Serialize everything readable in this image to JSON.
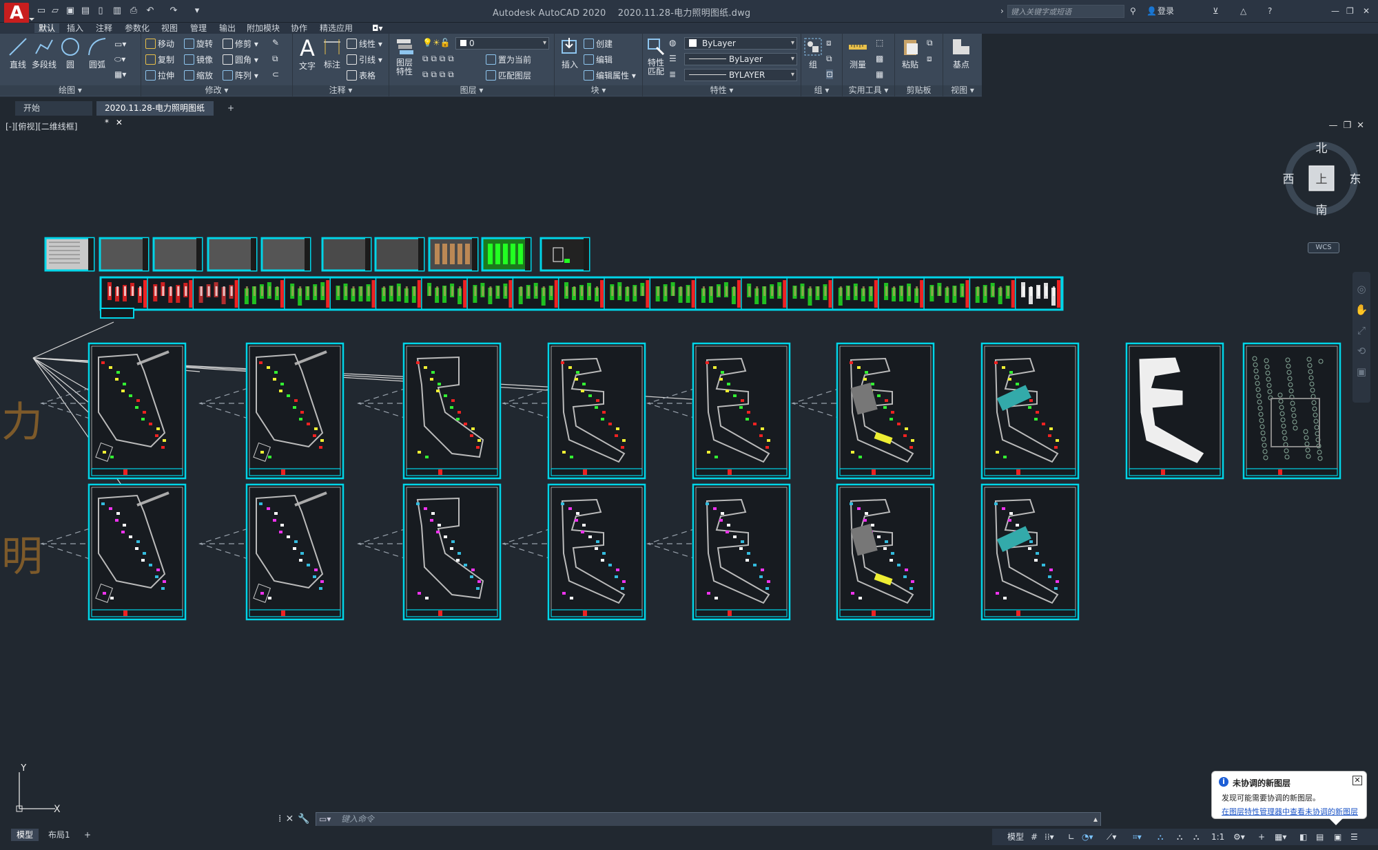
{
  "titlebar": {
    "logo": "A",
    "app_title": "Autodesk AutoCAD 2020",
    "file_name": "2020.11.28-电力照明图纸.dwg",
    "search_placeholder": "键入关键字或短语",
    "login": "登录",
    "window_buttons": [
      "—",
      "❐",
      "✕"
    ]
  },
  "menu_tabs": [
    "默认",
    "插入",
    "注释",
    "参数化",
    "视图",
    "管理",
    "输出",
    "附加模块",
    "协作",
    "精选应用"
  ],
  "ribbon": {
    "draw": {
      "title": "绘图",
      "tools": [
        "直线",
        "多段线",
        "圆",
        "圆弧"
      ]
    },
    "modify": {
      "title": "修改",
      "tools": [
        "移动",
        "旋转",
        "修剪",
        "复制",
        "镜像",
        "圆角",
        "拉伸",
        "缩放",
        "阵列"
      ]
    },
    "annotation": {
      "title": "注释",
      "tools": [
        "文字",
        "标注",
        "线性",
        "引线",
        "表格"
      ]
    },
    "layers": {
      "title": "图层",
      "tools": [
        "图层特性",
        "置为当前",
        "匹配图层"
      ],
      "current_layer": "0"
    },
    "block": {
      "title": "块",
      "tools": [
        "插入",
        "创建",
        "编辑",
        "编辑属性"
      ]
    },
    "properties": {
      "title": "特性",
      "tools": [
        "特性匹配"
      ],
      "color": "ByLayer",
      "linetype": "ByLayer",
      "lineweight": "BYLAYER"
    },
    "groups": {
      "title": "组",
      "tools": [
        "组"
      ]
    },
    "utilities": {
      "title": "实用工具",
      "tools": [
        "测量"
      ]
    },
    "clipboard": {
      "title": "剪贴板",
      "tools": [
        "粘贴"
      ]
    },
    "view": {
      "title": "视图",
      "tools": [
        "基点"
      ]
    }
  },
  "doc_tabs": [
    "开始",
    "2020.11.28-电力照明图纸*"
  ],
  "viewport_label": "[-][俯视][二维线框]",
  "viewcube": {
    "north": "北",
    "south": "南",
    "east": "东",
    "west": "西",
    "face": "上",
    "wcs": "WCS"
  },
  "canvas_text": [
    "力",
    "明"
  ],
  "ucs": {
    "x": "X",
    "y": "Y"
  },
  "command_placeholder": "键入命令",
  "layout_tabs": [
    "模型",
    "布局1"
  ],
  "status": {
    "model": "模型",
    "scale": "1:1"
  },
  "notification": {
    "title": "未协调的新图层",
    "desc": "发现可能需要协调的新图层。",
    "link": "在图层特性管理器中查看未协调的新图层"
  },
  "colors": {
    "accent": "#00d5e8",
    "background": "#212830",
    "ribbon": "#3b4858"
  }
}
